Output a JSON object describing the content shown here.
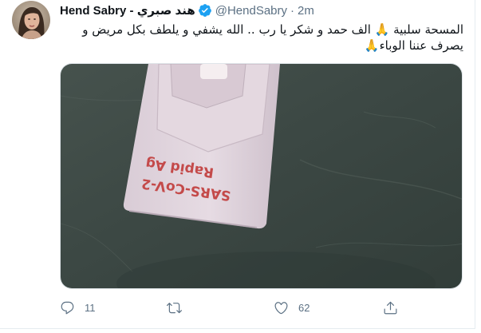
{
  "tweet": {
    "author": {
      "display_name": "Hend Sabry - هند صبري",
      "handle": "@HendSabry",
      "separator": "·",
      "time": "2m",
      "verified": true
    },
    "text_lines": [
      "المسحة سلبية 🙏 الف حمد و شكر يا رب .. الله يشفي و يلطف بكل  مريض و",
      "يصرف عننا الوباء🙏"
    ],
    "media": {
      "test_label_line1": "SARS-CoV-2",
      "test_label_line2": "Rapid Ag"
    },
    "actions": {
      "reply_count": "11",
      "retweet_count": "",
      "like_count": "62"
    }
  },
  "colors": {
    "verified_blue": "#1da1f2",
    "secondary_text": "#5b7083",
    "border": "#e6ecf0"
  },
  "icons": [
    "verified-badge-icon",
    "reply-icon",
    "retweet-icon",
    "like-icon",
    "share-icon",
    "folded-hands-emoji-icon"
  ]
}
